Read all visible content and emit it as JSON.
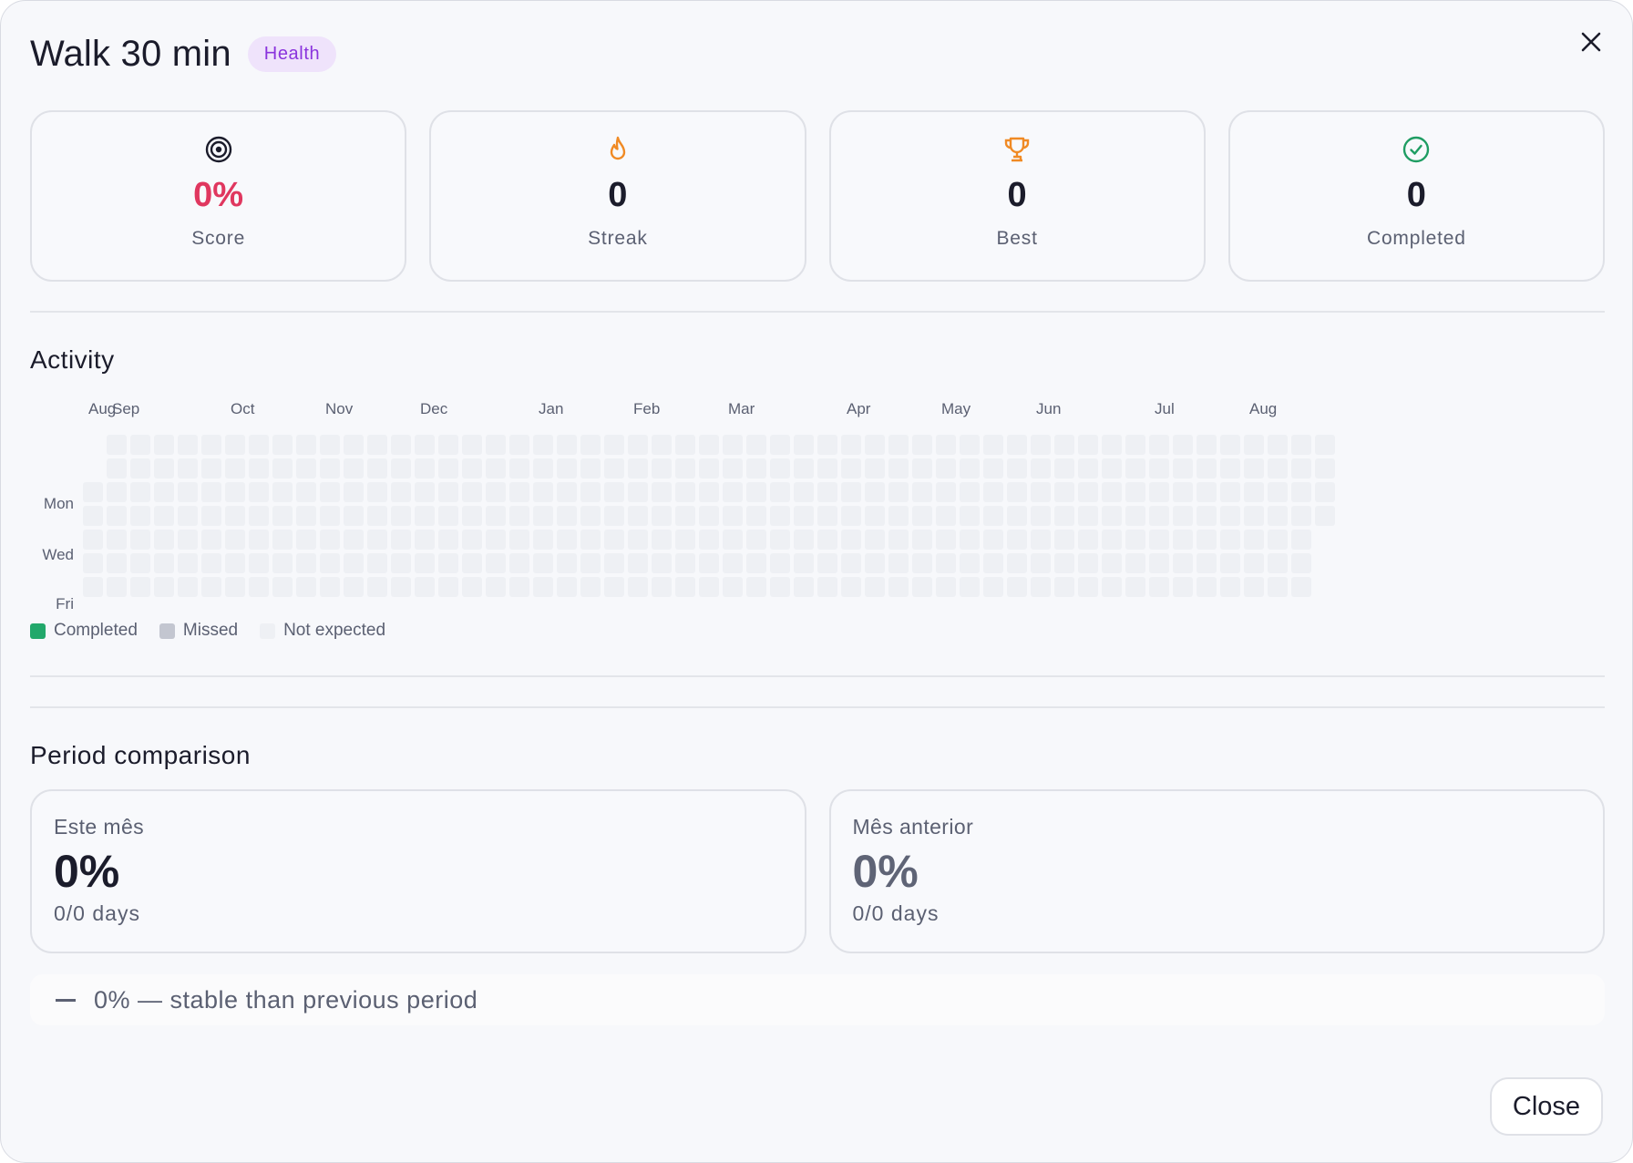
{
  "header": {
    "title": "Walk 30 min",
    "category_badge": "Health",
    "close_icon": "close-icon"
  },
  "stats": [
    {
      "icon": "target-icon",
      "value": "0%",
      "label": "Score",
      "color": "#e0375f"
    },
    {
      "icon": "flame-icon",
      "value": "0",
      "label": "Streak",
      "color": "#f08a24"
    },
    {
      "icon": "trophy-icon",
      "value": "0",
      "label": "Best",
      "color": "#f08a24"
    },
    {
      "icon": "check-circle-icon",
      "value": "0",
      "label": "Completed",
      "color": "#1f9d63"
    }
  ],
  "activity": {
    "title": "Activity",
    "months": [
      "Aug",
      "Sep",
      "Oct",
      "Nov",
      "Dec",
      "Jan",
      "Feb",
      "Mar",
      "Apr",
      "May",
      "Jun",
      "Jul",
      "Aug"
    ],
    "day_labels": [
      "Mon",
      "Wed",
      "Fri"
    ],
    "legend": [
      {
        "label": "Completed",
        "color": "#22a86b"
      },
      {
        "label": "Missed",
        "color": "#c3c6d0"
      },
      {
        "label": "Not expected",
        "color": "#eef0f4"
      }
    ]
  },
  "comparison": {
    "title": "Period comparison",
    "current": {
      "label": "Este mês",
      "value": "0%",
      "days": "0/0 days"
    },
    "previous": {
      "label": "Mês anterior",
      "value": "0%",
      "days": "0/0 days"
    },
    "trend_text": "0% — stable than previous period"
  },
  "footer": {
    "close_label": "Close"
  },
  "colors": {
    "accent_purple": "#8a34dd",
    "score_pink": "#e0375f",
    "streak_orange": "#f08a24",
    "completed_green": "#22a86b"
  }
}
